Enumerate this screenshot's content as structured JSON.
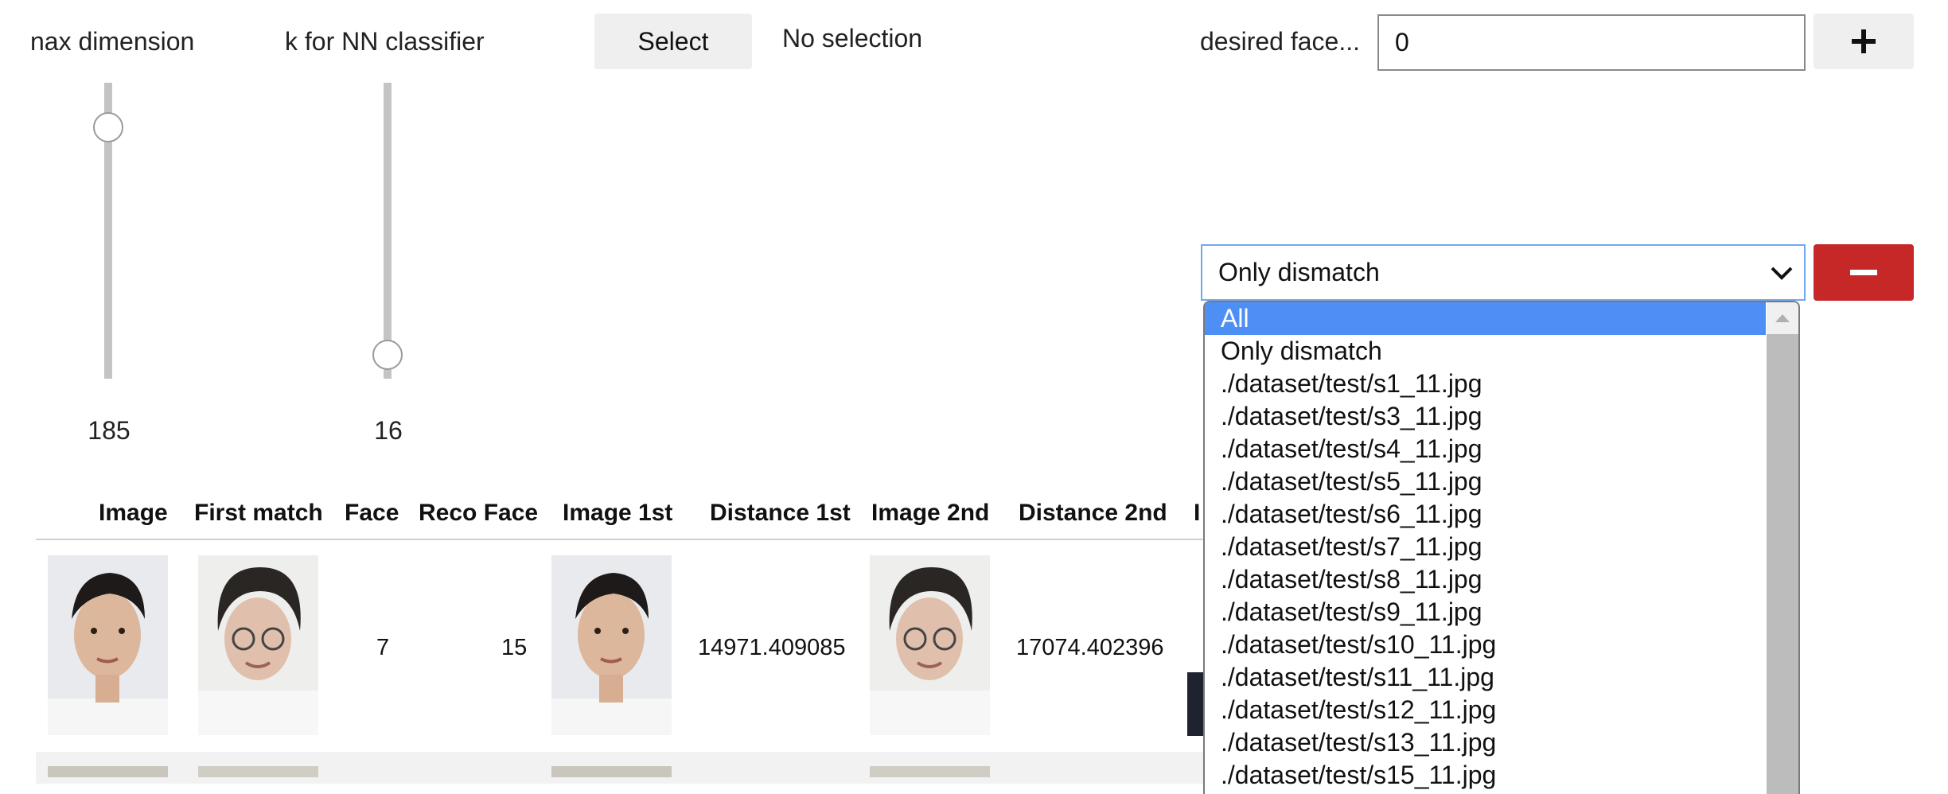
{
  "sliders": [
    {
      "label": "nax dimension",
      "value": "185",
      "level": 0.85
    },
    {
      "label": "k for NN classifier",
      "value": "16",
      "level": 0.08
    }
  ],
  "file_select": {
    "button_label": "Select",
    "status": "No selection"
  },
  "desired": {
    "label": "desired face...",
    "value": "0",
    "add_label": "+"
  },
  "filter_select": {
    "selected": "Only dismatch",
    "options": [
      "All",
      "Only dismatch",
      "./dataset/test/s1_11.jpg",
      "./dataset/test/s3_11.jpg",
      "./dataset/test/s4_11.jpg",
      "./dataset/test/s5_11.jpg",
      "./dataset/test/s6_11.jpg",
      "./dataset/test/s7_11.jpg",
      "./dataset/test/s8_11.jpg",
      "./dataset/test/s9_11.jpg",
      "./dataset/test/s10_11.jpg",
      "./dataset/test/s11_11.jpg",
      "./dataset/test/s12_11.jpg",
      "./dataset/test/s13_11.jpg",
      "./dataset/test/s15_11.jpg"
    ],
    "highlighted": "All"
  },
  "table": {
    "headers": [
      "Image",
      "First match",
      "Face",
      "Reco Face",
      "Image 1st",
      "Distance 1st",
      "Image 2nd",
      "Distance 2nd",
      "I"
    ],
    "rows": [
      {
        "face": "7",
        "reco_face": "15",
        "distance_1st": "14971.409085",
        "distance_2nd": "17074.402396"
      }
    ]
  },
  "colors": {
    "accent": "#4e8ff5",
    "danger": "#c62828",
    "button": "#efefef"
  },
  "icons": {
    "add": "plus-icon",
    "remove": "minus-icon",
    "select_arrow": "chevron-down-icon",
    "scroll_up": "scroll-up-icon"
  }
}
